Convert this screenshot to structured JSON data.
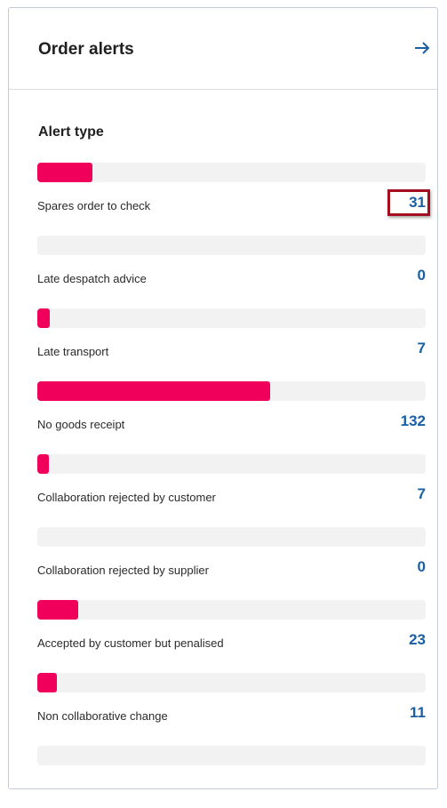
{
  "header": {
    "title": "Order alerts",
    "action_icon": "arrow-right-icon"
  },
  "section": {
    "title": "Alert type"
  },
  "colors": {
    "bar": "#f0005a",
    "track": "#f2f2f2",
    "count": "#1a5fa3",
    "highlight": "#a50e1f"
  },
  "alerts": [
    {
      "label": "Spares order to check",
      "count": "31",
      "highlighted": true
    },
    {
      "label": "Late despatch advice",
      "count": "0"
    },
    {
      "label": "Late transport",
      "count": "7"
    },
    {
      "label": "No goods receipt",
      "count": "132"
    },
    {
      "label": "Collaboration rejected by customer",
      "count": "7"
    },
    {
      "label": "Collaboration rejected by supplier",
      "count": "0"
    },
    {
      "label": "Accepted by customer but penalised",
      "count": "23"
    },
    {
      "label": "Non collaborative change",
      "count": "11"
    },
    {
      "label": "",
      "count": ""
    }
  ]
}
